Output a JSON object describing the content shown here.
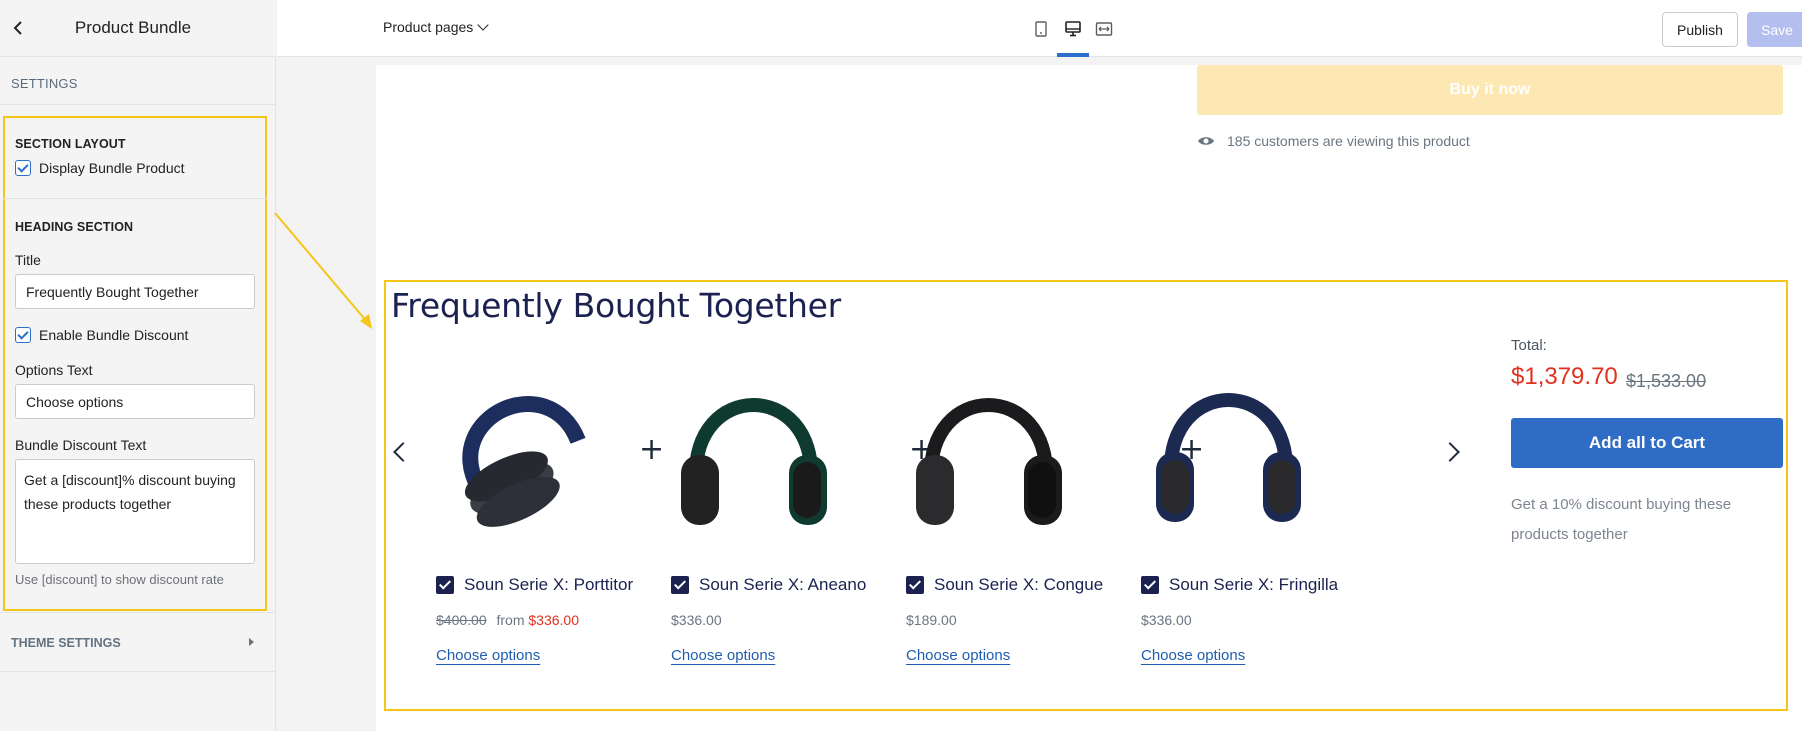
{
  "sidebar": {
    "title": "Product Bundle",
    "settings_label": "SETTINGS",
    "section_layout": {
      "heading": "SECTION LAYOUT",
      "display_bundle_label": "Display Bundle Product",
      "display_bundle_checked": true
    },
    "heading_section": {
      "heading": "HEADING SECTION",
      "title_label": "Title",
      "title_value": "Frequently Bought Together",
      "enable_discount_label": "Enable Bundle Discount",
      "enable_discount_checked": true,
      "options_text_label": "Options Text",
      "options_text_value": "Choose options",
      "discount_text_label": "Bundle Discount Text",
      "discount_text_value": "Get a [discount]% discount buying these products together",
      "help_text": "Use [discount] to show discount rate"
    },
    "theme_settings_label": "THEME SETTINGS"
  },
  "topbar": {
    "page_select": "Product pages",
    "view_modes": [
      "mobile-icon",
      "desktop-icon",
      "fullwidth-icon"
    ],
    "active_view": "desktop-icon",
    "publish_label": "Publish",
    "save_label": "Save"
  },
  "preview": {
    "buy_now_label": "Buy it now",
    "viewers_text": "185 customers are viewing this product",
    "bundle": {
      "title": "Frequently Bought Together",
      "products": [
        {
          "name": "Soun Serie X: Porttitor",
          "compare_price": "$400.00",
          "from_label": "from",
          "price": "$336.00",
          "color": "#1d2d5e",
          "action": "Choose options"
        },
        {
          "name": "Soun Serie X: Aneano",
          "compare_price": "",
          "from_label": "",
          "price": "$336.00",
          "color": "#0f3a30",
          "action": "Choose options"
        },
        {
          "name": "Soun Serie X: Congue",
          "compare_price": "",
          "from_label": "",
          "price": "$189.00",
          "color": "#1b1b1d",
          "action": "Choose options"
        },
        {
          "name": "Soun Serie X: Fringilla",
          "compare_price": "",
          "from_label": "",
          "price": "$336.00",
          "color": "#1c2a52",
          "action": "Choose options"
        }
      ],
      "plus_sign": "+",
      "total_label": "Total:",
      "total_price": "$1,379.70",
      "total_compare": "$1,533.00",
      "add_all_label": "Add all to Cart",
      "discount_text": "Get a 10% discount buying these products together"
    }
  },
  "colors": {
    "highlight": "#f5c518",
    "accent_blue": "#2e6cc6",
    "sale_red": "#e0311f",
    "title_navy": "#1b2250"
  }
}
